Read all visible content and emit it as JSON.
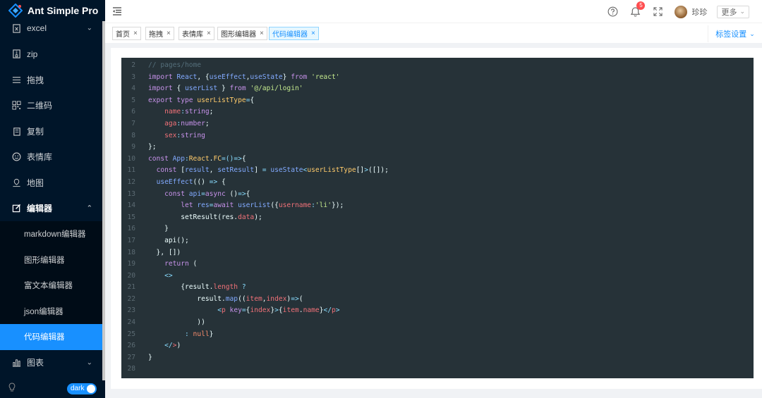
{
  "app": {
    "title": "Ant Simple Pro"
  },
  "sidebar": {
    "items": [
      {
        "label": "excel",
        "icon": "excel-file-icon",
        "arrow": "⌄"
      },
      {
        "label": "zip",
        "icon": "zip-file-icon"
      },
      {
        "label": "拖拽",
        "icon": "drag-menu-icon"
      },
      {
        "label": "二维码",
        "icon": "qrcode-icon"
      },
      {
        "label": "复制",
        "icon": "copy-icon"
      },
      {
        "label": "表情库",
        "icon": "smile-icon"
      },
      {
        "label": "地图",
        "icon": "map-pin-icon"
      },
      {
        "label": "编辑器",
        "icon": "edit-icon",
        "arrow": "⌃",
        "open": true
      },
      {
        "label": "图表",
        "icon": "bar-chart-icon",
        "arrow": "⌄"
      }
    ],
    "editor_subitems": [
      {
        "label": "markdown编辑器"
      },
      {
        "label": "图形编辑器"
      },
      {
        "label": "富文本编辑器"
      },
      {
        "label": "json编辑器"
      },
      {
        "label": "代码编辑器",
        "active": true
      }
    ],
    "theme_toggle_label": "dark"
  },
  "header": {
    "notification_count": "5",
    "username": "珍珍",
    "more_label": "更多",
    "more_caret": "⌄"
  },
  "tabs": {
    "items": [
      {
        "label": "首页"
      },
      {
        "label": "拖拽"
      },
      {
        "label": "表情库"
      },
      {
        "label": "图形编辑器"
      },
      {
        "label": "代码编辑器",
        "active": true
      }
    ],
    "close_glyph": "×",
    "settings_label": "标签设置",
    "settings_caret": "⌄"
  },
  "editor": {
    "lines": [
      {
        "n": "2",
        "tokens": [
          [
            "comment",
            "// pages/home"
          ]
        ]
      },
      {
        "n": "3",
        "tokens": [
          [
            "kw",
            "import "
          ],
          [
            "var",
            "React"
          ],
          [
            "plain",
            ", {"
          ],
          [
            "var",
            "useEffect"
          ],
          [
            "plain",
            ","
          ],
          [
            "var",
            "useState"
          ],
          [
            "plain",
            "} "
          ],
          [
            "kw",
            "from "
          ],
          [
            "str",
            "'react'"
          ]
        ]
      },
      {
        "n": "4",
        "tokens": [
          [
            "kw",
            "import "
          ],
          [
            "plain",
            "{ "
          ],
          [
            "var",
            "userList"
          ],
          [
            "plain",
            " } "
          ],
          [
            "kw",
            "from "
          ],
          [
            "str",
            "'@/api/login'"
          ]
        ]
      },
      {
        "n": "5",
        "tokens": [
          [
            "kw",
            "export type "
          ],
          [
            "type",
            "userListType"
          ],
          [
            "op",
            "="
          ],
          [
            "plain",
            "{"
          ]
        ]
      },
      {
        "n": "6",
        "tokens": [
          [
            "plain",
            "    "
          ],
          [
            "prop",
            "name"
          ],
          [
            "op",
            ":"
          ],
          [
            "kw",
            "string"
          ],
          [
            "plain",
            ";"
          ]
        ]
      },
      {
        "n": "7",
        "tokens": [
          [
            "plain",
            "    "
          ],
          [
            "prop",
            "aga"
          ],
          [
            "op",
            ":"
          ],
          [
            "kw",
            "number"
          ],
          [
            "plain",
            ";"
          ]
        ]
      },
      {
        "n": "8",
        "tokens": [
          [
            "plain",
            "    "
          ],
          [
            "prop",
            "sex"
          ],
          [
            "op",
            ":"
          ],
          [
            "kw",
            "string"
          ]
        ]
      },
      {
        "n": "9",
        "tokens": [
          [
            "plain",
            "};"
          ]
        ]
      },
      {
        "n": "10",
        "tokens": [
          [
            "kw",
            "const "
          ],
          [
            "var",
            "App"
          ],
          [
            "op",
            ":"
          ],
          [
            "type",
            "React"
          ],
          [
            "plain",
            "."
          ],
          [
            "type",
            "FC"
          ],
          [
            "op",
            "=()=>"
          ],
          [
            "plain",
            "{"
          ]
        ]
      },
      {
        "n": "11",
        "tokens": [
          [
            "plain",
            "  "
          ],
          [
            "kw",
            "const "
          ],
          [
            "plain",
            "["
          ],
          [
            "var",
            "result"
          ],
          [
            "plain",
            ", "
          ],
          [
            "var",
            "setResult"
          ],
          [
            "plain",
            "] "
          ],
          [
            "op",
            "= "
          ],
          [
            "var",
            "useState"
          ],
          [
            "op",
            "<"
          ],
          [
            "type",
            "userListType"
          ],
          [
            "plain",
            "[]"
          ],
          [
            "op",
            ">"
          ],
          [
            "plain",
            "([]);"
          ]
        ]
      },
      {
        "n": "12",
        "tokens": [
          [
            "plain",
            "  "
          ],
          [
            "var",
            "useEffect"
          ],
          [
            "plain",
            "(() "
          ],
          [
            "op",
            "=> "
          ],
          [
            "plain",
            "{"
          ]
        ]
      },
      {
        "n": "13",
        "tokens": [
          [
            "plain",
            "    "
          ],
          [
            "kw",
            "const "
          ],
          [
            "var",
            "api"
          ],
          [
            "op",
            "="
          ],
          [
            "kw",
            "async "
          ],
          [
            "plain",
            "()"
          ],
          [
            "op",
            "=>"
          ],
          [
            "plain",
            "{"
          ]
        ]
      },
      {
        "n": "14",
        "tokens": [
          [
            "plain",
            "        "
          ],
          [
            "kw",
            "let "
          ],
          [
            "var",
            "res"
          ],
          [
            "op",
            "="
          ],
          [
            "kw",
            "await "
          ],
          [
            "var",
            "userList"
          ],
          [
            "plain",
            "({"
          ],
          [
            "prop",
            "username"
          ],
          [
            "op",
            ":"
          ],
          [
            "str",
            "'li'"
          ],
          [
            "plain",
            "});"
          ]
        ]
      },
      {
        "n": "15",
        "tokens": [
          [
            "plain",
            "        setResult(res."
          ],
          [
            "prop",
            "data"
          ],
          [
            "plain",
            ");"
          ]
        ]
      },
      {
        "n": "16",
        "tokens": [
          [
            "plain",
            "    }"
          ]
        ]
      },
      {
        "n": "17",
        "tokens": [
          [
            "plain",
            "    api();"
          ]
        ]
      },
      {
        "n": "18",
        "tokens": [
          [
            "plain",
            "  }, [])"
          ]
        ]
      },
      {
        "n": "19",
        "tokens": [
          [
            "plain",
            "    "
          ],
          [
            "kw",
            "return "
          ],
          [
            "plain",
            "("
          ]
        ]
      },
      {
        "n": "20",
        "tokens": [
          [
            "plain",
            "    "
          ],
          [
            "op",
            "<>"
          ]
        ]
      },
      {
        "n": "21",
        "tokens": [
          [
            "plain",
            "        {result."
          ],
          [
            "prop",
            "length"
          ],
          [
            "plain",
            " "
          ],
          [
            "op",
            "?"
          ]
        ]
      },
      {
        "n": "22",
        "tokens": [
          [
            "plain",
            "            result."
          ],
          [
            "var",
            "map"
          ],
          [
            "plain",
            "(("
          ],
          [
            "prop",
            "item"
          ],
          [
            "plain",
            ","
          ],
          [
            "prop",
            "index"
          ],
          [
            "plain",
            ")"
          ],
          [
            "op",
            "=>"
          ],
          [
            "plain",
            "("
          ]
        ]
      },
      {
        "n": "23",
        "tokens": [
          [
            "plain",
            "                 "
          ],
          [
            "op",
            "<"
          ],
          [
            "prop",
            "p "
          ],
          [
            "kw",
            "key"
          ],
          [
            "op",
            "="
          ],
          [
            "plain",
            "{"
          ],
          [
            "prop",
            "index"
          ],
          [
            "plain",
            "}"
          ],
          [
            "op",
            ">"
          ],
          [
            "plain",
            "{"
          ],
          [
            "prop",
            "item"
          ],
          [
            "plain",
            "."
          ],
          [
            "prop",
            "name"
          ],
          [
            "plain",
            "}"
          ],
          [
            "op",
            "</"
          ],
          [
            "prop",
            "p"
          ],
          [
            "op",
            ">"
          ]
        ]
      },
      {
        "n": "24",
        "tokens": [
          [
            "plain",
            "            ))"
          ]
        ]
      },
      {
        "n": "25",
        "tokens": [
          [
            "plain",
            "         "
          ],
          [
            "op",
            ": "
          ],
          [
            "num",
            "null"
          ],
          [
            "plain",
            "}"
          ]
        ]
      },
      {
        "n": "26",
        "tokens": [
          [
            "plain",
            "    "
          ],
          [
            "op",
            "</"
          ],
          [
            "prop",
            ">"
          ],
          [
            "plain",
            ")"
          ]
        ]
      },
      {
        "n": "27",
        "tokens": [
          [
            "plain",
            "}"
          ]
        ]
      },
      {
        "n": "28",
        "tokens": []
      }
    ]
  }
}
